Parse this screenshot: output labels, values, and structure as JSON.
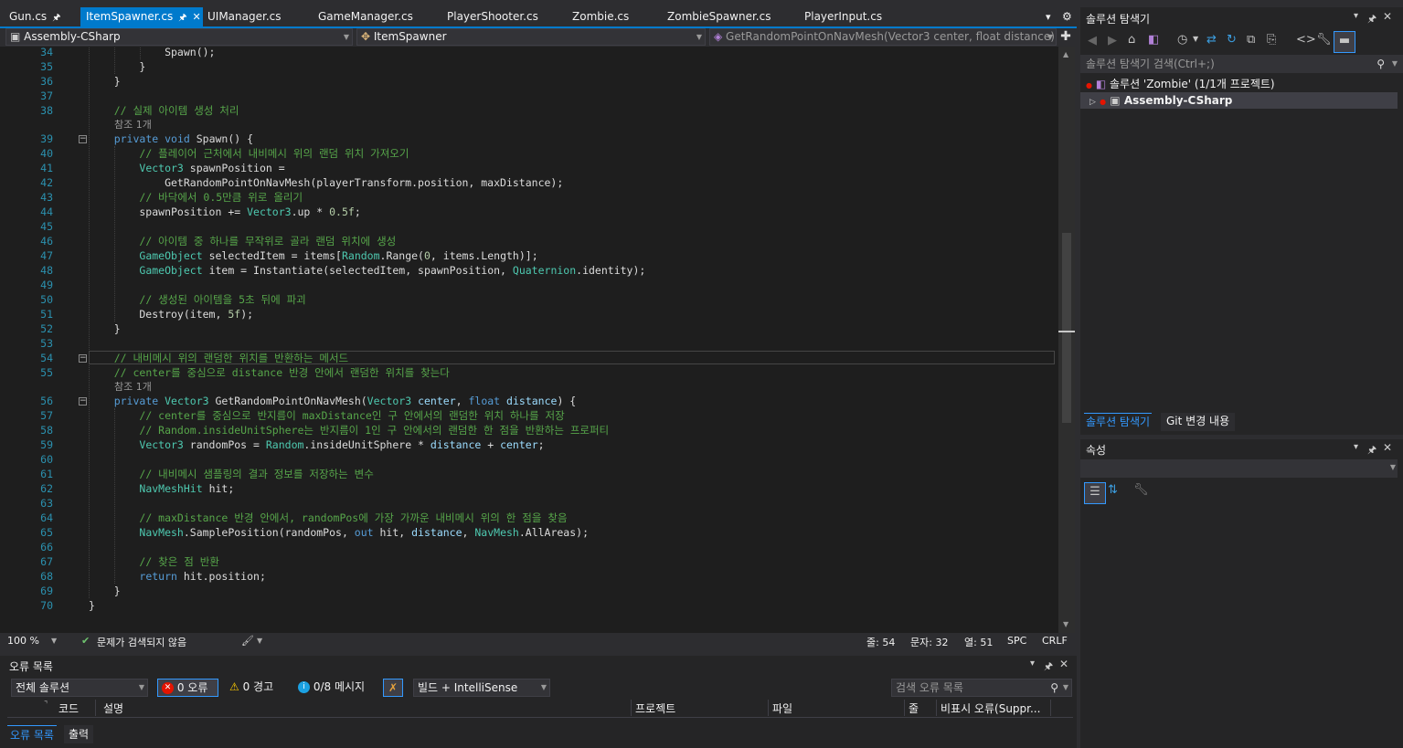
{
  "tabs": [
    {
      "label": "Gun.cs",
      "pinned": true,
      "active": false
    },
    {
      "label": "ItemSpawner.cs",
      "pinned": true,
      "active": true
    },
    {
      "label": "UIManager.cs",
      "active": false
    },
    {
      "label": "GameManager.cs",
      "active": false
    },
    {
      "label": "PlayerShooter.cs",
      "active": false
    },
    {
      "label": "Zombie.cs",
      "active": false
    },
    {
      "label": "ZombieSpawner.cs",
      "active": false
    },
    {
      "label": "PlayerInput.cs",
      "active": false
    }
  ],
  "nav": {
    "project": "Assembly-CSharp",
    "class": "ItemSpawner",
    "member": "GetRandomPointOnNavMesh(Vector3 center, float distance)"
  },
  "editor": {
    "reference_label": "참조 1개",
    "current_line": 54,
    "lines": [
      {
        "n": 34,
        "t": "            Spawn();"
      },
      {
        "n": 35,
        "t": "        }"
      },
      {
        "n": 36,
        "t": "    }"
      },
      {
        "n": 37,
        "t": ""
      },
      {
        "n": 38,
        "t": "    // 실제 아이템 생성 처리",
        "c": 1
      },
      {
        "n": 39,
        "t": "    private void Spawn() {",
        "ref": true
      },
      {
        "n": 40,
        "t": "        // 플레이어 근처에서 내비메시 위의 랜덤 위치 가져오기",
        "c": 1
      },
      {
        "n": 41,
        "t": "        Vector3 spawnPosition ="
      },
      {
        "n": 42,
        "t": "            GetRandomPointOnNavMesh(playerTransform.position, maxDistance);"
      },
      {
        "n": 43,
        "t": "        // 바닥에서 0.5만큼 위로 올리기",
        "c": 1
      },
      {
        "n": 44,
        "t": "        spawnPosition += Vector3.up * 0.5f;"
      },
      {
        "n": 45,
        "t": ""
      },
      {
        "n": 46,
        "t": "        // 아이템 중 하나를 무작위로 골라 랜덤 위치에 생성",
        "c": 1
      },
      {
        "n": 47,
        "t": "        GameObject selectedItem = items[Random.Range(0, items.Length)];"
      },
      {
        "n": 48,
        "t": "        GameObject item = Instantiate(selectedItem, spawnPosition, Quaternion.identity);"
      },
      {
        "n": 49,
        "t": ""
      },
      {
        "n": 50,
        "t": "        // 생성된 아이템을 5초 뒤에 파괴",
        "c": 1
      },
      {
        "n": 51,
        "t": "        Destroy(item, 5f);"
      },
      {
        "n": 52,
        "t": "    }"
      },
      {
        "n": 53,
        "t": ""
      },
      {
        "n": 54,
        "t": "    // 내비메시 위의 랜덤한 위치를 반환하는 메서드",
        "c": 1
      },
      {
        "n": 55,
        "t": "    // center를 중심으로 distance 반경 안에서 랜덤한 위치를 찾는다",
        "c": 1
      },
      {
        "n": 56,
        "t": "    private Vector3 GetRandomPointOnNavMesh(Vector3 center, float distance) {",
        "ref": true
      },
      {
        "n": 57,
        "t": "        // center를 중심으로 반지름이 maxDistance인 구 안에서의 랜덤한 위치 하나를 저장",
        "c": 1
      },
      {
        "n": 58,
        "t": "        // Random.insideUnitSphere는 반지름이 1인 구 안에서의 랜덤한 한 점을 반환하는 프로퍼티",
        "c": 1
      },
      {
        "n": 59,
        "t": "        Vector3 randomPos = Random.insideUnitSphere * distance + center;"
      },
      {
        "n": 60,
        "t": ""
      },
      {
        "n": 61,
        "t": "        // 내비메시 샘플링의 결과 정보를 저장하는 변수",
        "c": 1
      },
      {
        "n": 62,
        "t": "        NavMeshHit hit;"
      },
      {
        "n": 63,
        "t": ""
      },
      {
        "n": 64,
        "t": "        // maxDistance 반경 안에서, randomPos에 가장 가까운 내비메시 위의 한 점을 찾음",
        "c": 1
      },
      {
        "n": 65,
        "t": "        NavMesh.SamplePosition(randomPos, out hit, distance, NavMesh.AllAreas);"
      },
      {
        "n": 66,
        "t": ""
      },
      {
        "n": 67,
        "t": "        // 찾은 점 반환",
        "c": 1
      },
      {
        "n": 68,
        "t": "        return hit.position;"
      },
      {
        "n": 69,
        "t": "    }"
      },
      {
        "n": 70,
        "t": "}"
      }
    ]
  },
  "status": {
    "zoom": "100 %",
    "issues": "문제가 검색되지 않음",
    "line": "줄: 54",
    "char": "문자: 32",
    "col": "열: 51",
    "spc": "SPC",
    "crlf": "CRLF"
  },
  "errors": {
    "title": "오류 목록",
    "scope": "전체 솔루션",
    "errors_label": "0 오류",
    "warnings_label": "0 경고",
    "messages_label": "0/8 메시지",
    "build_filter": "빌드 + IntelliSense",
    "search_placeholder": "검색 오류 목록",
    "columns": [
      "코드",
      "설명",
      "프로젝트",
      "파일",
      "줄",
      "비표시 오류(Suppr..."
    ],
    "bottom_tabs": [
      "오류 목록",
      "출력"
    ]
  },
  "solution": {
    "title": "솔루션 탐색기",
    "search_placeholder": "솔루션 탐색기 검색(Ctrl+;)",
    "root": "솔루션 'Zombie' (1/1개 프로젝트)",
    "project": "Assembly-CSharp",
    "bottom_tabs": [
      "솔루션 탐색기",
      "Git 변경 내용"
    ]
  },
  "properties": {
    "title": "속성"
  },
  "colors": {
    "accent": "#007acc",
    "comment": "#57a64a",
    "keyword": "#569cd6",
    "type": "#4ec9b0",
    "error": "#e51400",
    "warning": "#ffcc00"
  }
}
